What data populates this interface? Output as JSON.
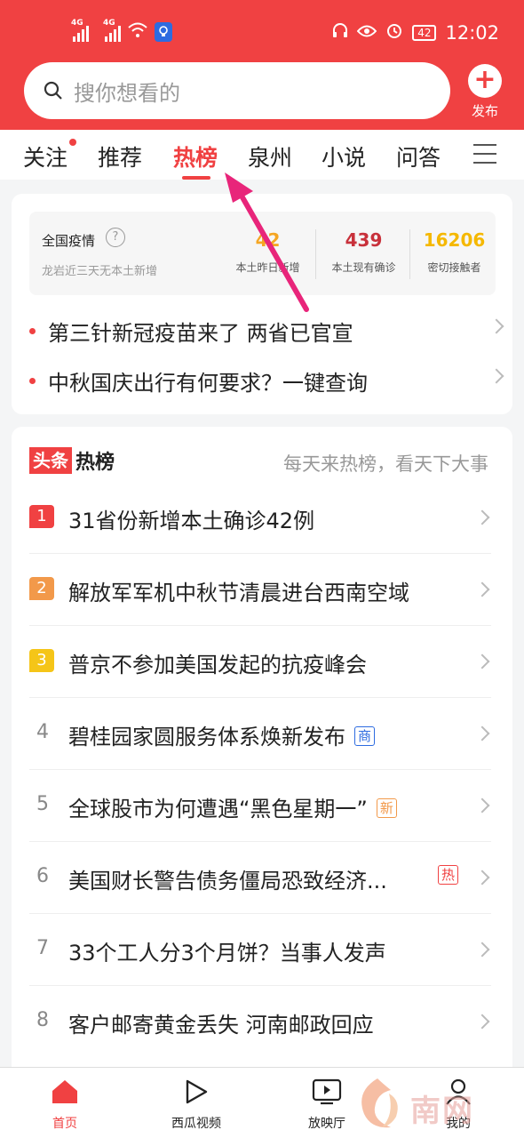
{
  "status": {
    "sig1": "4G",
    "sig2": "4G",
    "battery": "42",
    "time": "12:02"
  },
  "search": {
    "placeholder": "搜你想看的",
    "publish_label": "发布"
  },
  "tabs": [
    "关注",
    "推荐",
    "热榜",
    "泉州",
    "小说",
    "问答"
  ],
  "active_tab": "热榜",
  "covid": {
    "title": "全国疫情",
    "subtitle": "龙岩近三天无本土新增",
    "stats": [
      {
        "value": "42",
        "label": "本土昨日新增",
        "color": "#f5a623"
      },
      {
        "value": "439",
        "label": "本土现有确诊",
        "color": "#c8313b"
      },
      {
        "value": "16206",
        "label": "密切接触者",
        "color": "#f5b800"
      }
    ]
  },
  "news": [
    "第三针新冠疫苗来了 两省已官宣",
    "中秋国庆出行有何要求？一键查询"
  ],
  "hot": {
    "logo_red": "头条",
    "logo_black": "热榜",
    "slogan": "每天来热榜，看天下大事",
    "items": [
      {
        "rank": "1",
        "text": "31省份新增本土确诊42例",
        "tag": ""
      },
      {
        "rank": "2",
        "text": "解放军军机中秋节清晨进台西南空域",
        "tag": ""
      },
      {
        "rank": "3",
        "text": "普京不参加美国发起的抗疫峰会",
        "tag": ""
      },
      {
        "rank": "4",
        "text": "碧桂园家圆服务体系焕新发布",
        "tag": "商"
      },
      {
        "rank": "5",
        "text": "全球股市为何遭遇“黑色星期一”",
        "tag": "新"
      },
      {
        "rank": "6",
        "text": "美国财长警告债务僵局恐致经济...",
        "tag": "热"
      },
      {
        "rank": "7",
        "text": "33个工人分3个月饼？当事人发声",
        "tag": ""
      },
      {
        "rank": "8",
        "text": "客户邮寄黄金丢失 河南邮政回应",
        "tag": ""
      }
    ]
  },
  "nav": [
    "首页",
    "西瓜视频",
    "放映厅",
    "我的"
  ],
  "colors": {
    "brand": "#f04142",
    "rank1": "#f04142",
    "rank2": "#f2994a",
    "rank3": "#f5c518",
    "tag_shang": "#2d6be0",
    "tag_xin": "#f2994a",
    "tag_re": "#f04142"
  }
}
